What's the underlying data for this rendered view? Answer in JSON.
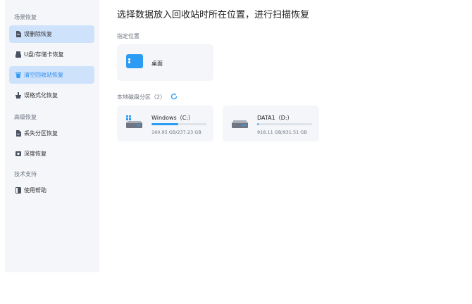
{
  "sidebar": {
    "sections": [
      {
        "title": "场景恢复"
      },
      {
        "title": "高级恢复"
      },
      {
        "title": "技术支持"
      }
    ],
    "items": [
      {
        "label": "误删除恢复",
        "icon": "document-icon"
      },
      {
        "label": "U盘/存储卡恢复",
        "icon": "usb-icon"
      },
      {
        "label": "清空回收站恢复",
        "icon": "recycle-bin-icon"
      },
      {
        "label": "误格式化恢复",
        "icon": "format-icon"
      },
      {
        "label": "丢失分区恢复",
        "icon": "partition-icon"
      },
      {
        "label": "深度恢复",
        "icon": "deep-scan-icon"
      },
      {
        "label": "使用帮助",
        "icon": "help-book-icon"
      }
    ]
  },
  "main": {
    "title": "选择数据放入回收站时所在位置，进行扫描恢复",
    "location_label": "指定位置",
    "desktop_label": "桌面",
    "disks_label": "本地磁盘分区（2）",
    "disks": [
      {
        "name": "Windows（C:）",
        "size": "160.95 GB/237.23 GB",
        "used_fraction": 0.49
      },
      {
        "name": "DATA1（D:）",
        "size": "918.11 GB/931.51 GB",
        "used_fraction": 0.02
      }
    ]
  },
  "colors": {
    "accent": "#2b9bf4",
    "active_bg": "#cfe2fb",
    "sidebar_bg": "#f4f6f9"
  }
}
